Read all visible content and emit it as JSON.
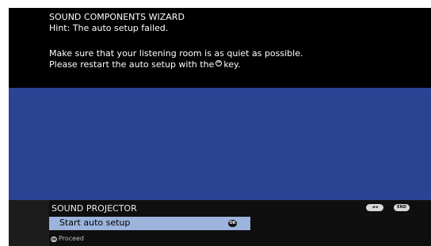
{
  "wizard": {
    "title": "SOUND COMPONENTS WIZARD",
    "hint": "Hint: The auto setup failed.",
    "message_line1": "Make sure that your listening room is as quiet as possible.",
    "message_line2_pre": "Please restart the auto setup with the",
    "message_line2_key_icon": "return-key-icon",
    "message_line2_post": "key."
  },
  "menu": {
    "title": "SOUND PROJECTOR",
    "items": [
      {
        "label": "Start auto setup",
        "badge": "OK",
        "selected": true
      }
    ]
  },
  "footer": {
    "badge": "OK",
    "hint": "Proceed"
  },
  "nav_buttons": {
    "back": "◄◄",
    "end": "END"
  },
  "colors": {
    "top_panel": "#000000",
    "blue_panel": "#2c4394",
    "menu_panel": "#0f0f0f",
    "selected_item": "#9db4dc"
  }
}
